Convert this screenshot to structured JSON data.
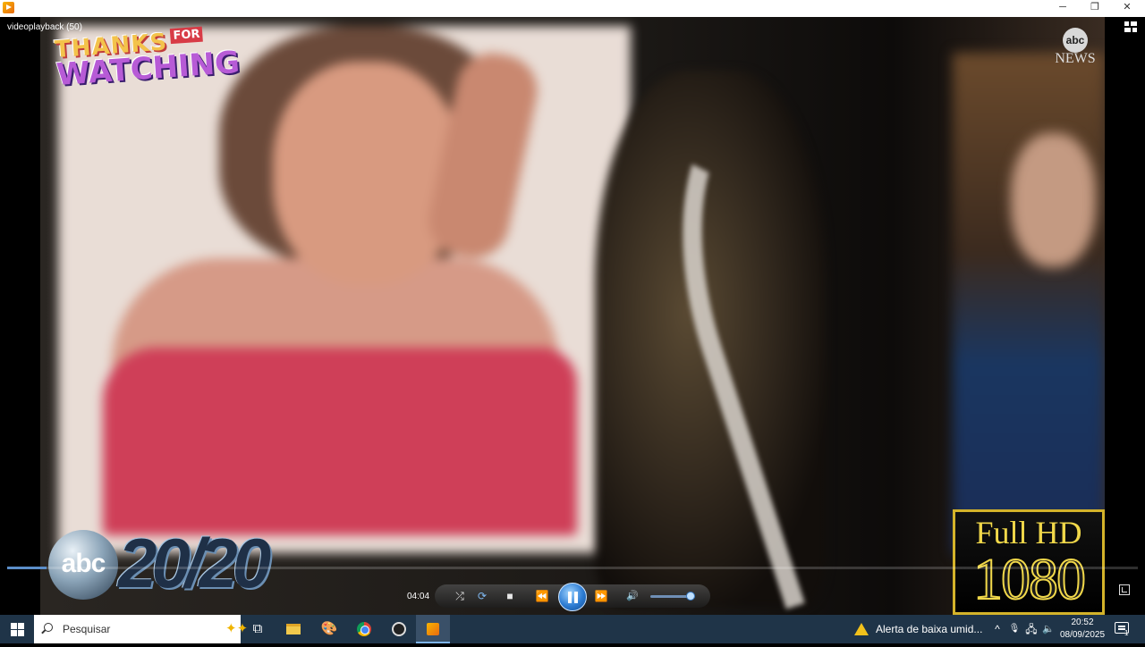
{
  "window": {
    "title": "videoplayback (50)",
    "minimize_glyph": "─",
    "maximize_glyph": "❐",
    "close_glyph": "✕"
  },
  "overlay": {
    "thanks_line1": "THANKS",
    "thanks_for": "FOR",
    "thanks_line2": "WATCHING",
    "network_logo": "abc",
    "network_name": "NEWS",
    "show_logo_abc": "abc",
    "show_logo_number": "20/20",
    "badge_line1": "Full HD",
    "badge_line2": "1080"
  },
  "player": {
    "time": "04:04",
    "progress": 0.035,
    "volume": 0.9,
    "icons": {
      "shuffle": "shuffle-icon",
      "repeat": "repeat-icon",
      "stop": "stop-icon",
      "previous": "rewind-icon",
      "play_pause": "pause-icon",
      "next": "fast-forward-icon",
      "volume": "speaker-icon",
      "fullscreen": "fullscreen-icon",
      "switch_view": "switch-view-icon"
    },
    "shuffle_glyph": "⤮",
    "repeat_glyph": "⟳",
    "stop_glyph": "■",
    "previous_glyph": "⏪",
    "next_glyph": "⏩",
    "volume_glyph": "🔊"
  },
  "taskbar": {
    "search_placeholder": "Pesquisar",
    "search_sparkle": "✦✦",
    "task_view_glyph": "⧉",
    "alert_text": "Alerta de baixa umid...",
    "tray_chevron": "^",
    "tray_mic": "🎙",
    "tray_network": "🖧",
    "tray_volume": "🔈",
    "clock_time": "20:52",
    "clock_date": "08/09/2025",
    "notifications_count": "1"
  },
  "colors": {
    "accent": "#5b8ec9",
    "taskbar_bg": "#1f3448",
    "alert_yellow": "#f2c11b"
  }
}
